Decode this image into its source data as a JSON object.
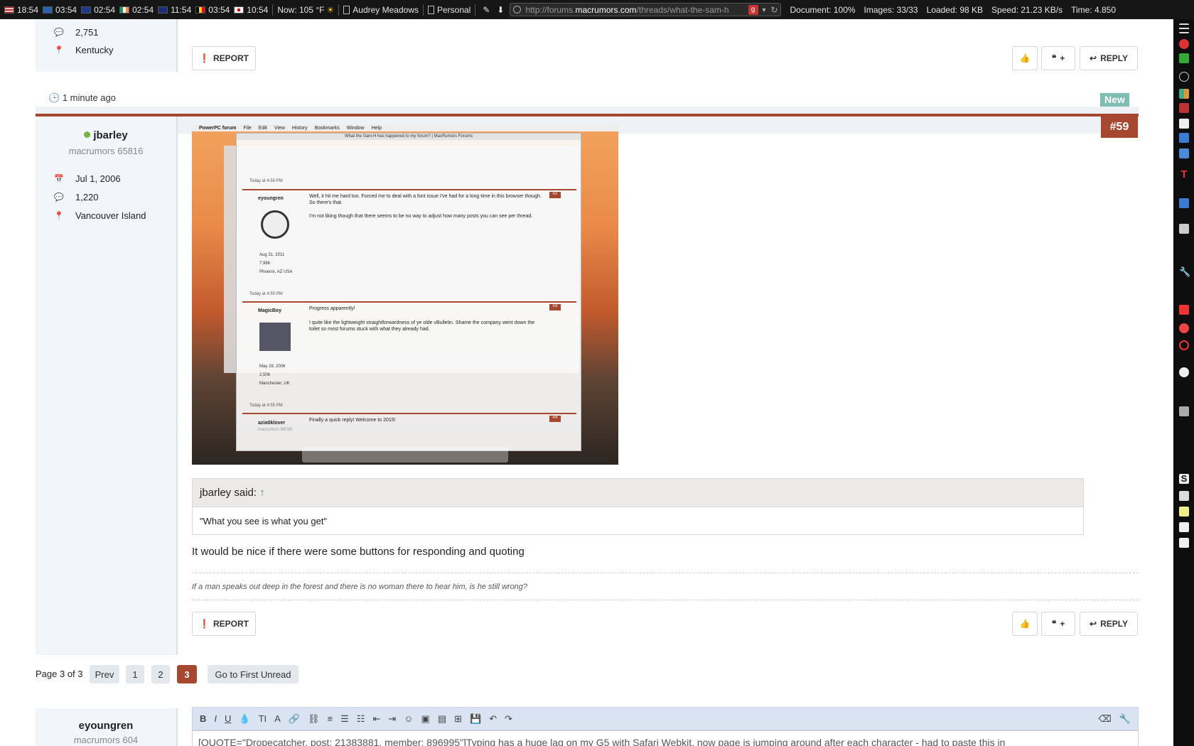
{
  "topbar": {
    "clocks": [
      {
        "flag": "us",
        "time": "18:54"
      },
      {
        "flag": "se",
        "time": "03:54"
      },
      {
        "flag": "uk",
        "time": "02:54"
      },
      {
        "flag": "ie",
        "time": "02:54"
      },
      {
        "flag": "au",
        "time": "11:54"
      },
      {
        "flag": "be",
        "time": "03:54"
      },
      {
        "flag": "jp",
        "time": "10:54"
      }
    ],
    "weather": "Now: 105 °F",
    "profile_name": "Audrey Meadows",
    "profile_label": "Personal",
    "url_prefix": "http://forums.",
    "url_domain": "macrumors.com",
    "url_suffix": "/threads/what-the-sam-h",
    "search_engine_icon": "g",
    "document": "Document: 100%",
    "images": "Images: 33/33",
    "loaded": "Loaded: 98 KB",
    "speed": "Speed: 21.23 KB/s",
    "time": "Time: 4.850"
  },
  "prev_post": {
    "messages": "2,751",
    "location": "Kentucky",
    "report_label": "REPORT",
    "quote_label": "+",
    "reply_label": "REPLY"
  },
  "post": {
    "time_ago": "1 minute ago",
    "new_badge": "New",
    "number": "#59",
    "username": "jbarley",
    "user_title": "macrumors 65816",
    "joined": "Jul 1, 2006",
    "messages": "1,220",
    "location": "Vancouver Island",
    "quote_author": "jbarley said:",
    "quote_arrow": "↑",
    "quote_text": "\"What you see is what you get\"",
    "body": "It would be nice if there were some buttons for responding and quoting",
    "signature": "If a man speaks out deep in the forest and there is no woman there to hear him, is he still wrong?",
    "report_label": "REPORT",
    "quote_label": "+",
    "reply_label": "REPLY"
  },
  "screenshot_content": {
    "menubar": [
      "PowerPC forum",
      "File",
      "Edit",
      "View",
      "History",
      "Bookmarks",
      "Window",
      "Help"
    ],
    "window_title": "What the Sam-H has happened to my forum? | MacRumors Forums",
    "posts": [
      {
        "time": "Today at 4:50 PM",
        "num": "#2",
        "user": "eyoungren",
        "text1": "Well, it hit me hard too. Forced me to deal with a font issue I've had for a long time in this browser though. So there's that.",
        "text2": "I'm not liking though that there seems to be no way to adjust how many posts you can see per thread.",
        "joined": "Aug 31, 2011",
        "messages": "7,986",
        "location": "Phoenix, AZ USA"
      },
      {
        "time": "Today at 4:50 PM",
        "num": "#3",
        "user": "MagicBoy",
        "text1": "Progress apparently!",
        "text2": "I quite like the lightweight straightforwardness of ye olde vBulletin. Shame the company went down the toilet so most forums stuck with what they already had.",
        "joined": "May 28, 2006",
        "messages": "2,506",
        "location": "Manchester, UK"
      },
      {
        "time": "Today at 4:55 PM",
        "num": "#4",
        "user": "aziatiklover",
        "user_title": "macrumors 68030",
        "text1": "Finally a quick reply! Welcome to 2015!"
      }
    ]
  },
  "pagination": {
    "label": "Page 3 of 3",
    "prev": "Prev",
    "pages": [
      "1",
      "2",
      "3"
    ],
    "current": "3",
    "first_unread": "Go to First Unread"
  },
  "reply_box": {
    "username": "eyoungren",
    "user_title": "macrumors 604",
    "editor_text": "[QUOTE=\"Dropecatcher, post: 21383881, member: 896995\"]Typing has a huge lag on my G5 with Safari Webkit, now page is jumping around after each character - had to paste this in"
  },
  "colors": {
    "accent": "#a6472f",
    "new_badge": "#7fbcb1",
    "online": "#7cb342",
    "link": "#5b7fa6"
  }
}
